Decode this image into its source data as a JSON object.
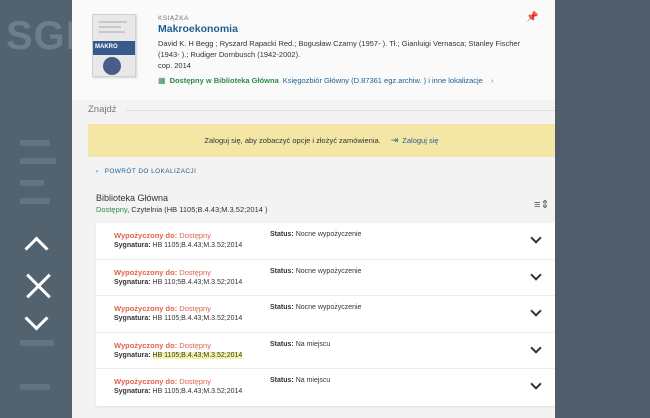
{
  "background": {
    "logo_text": "SGH"
  },
  "record": {
    "type": "KSIĄŻKA",
    "title": "Makroekonomia",
    "authors": "David K. H Begg ; Ryszard Rapacki Red.; Bogusław Czarny (1957- ). Tł.; Gianluigi Vernasca; Stanley Fischer (1943- ).; Rudiger Dornbusch (1942-2002).",
    "date": "cop. 2014",
    "availability_status": "Dostępny w Biblioteka Główna",
    "availability_location": "Księgozbiór Główny (D.87361 egz.archiw. ) i inne lokalizacje",
    "cover_band_text": "MAKRO"
  },
  "find": {
    "label": "Znajdź"
  },
  "login": {
    "message": "Zaloguj się, aby zobaczyć opcje i złożyć zamówienia.",
    "link_label": "Zaloguj się"
  },
  "back": {
    "label": "POWRÓT DO LOKALIZACJI"
  },
  "location": {
    "name": "Biblioteka Główna",
    "status": "Dostępny",
    "detail": ", Czytelnia (HB 1105;B.4.43;M.3.52;2014 )"
  },
  "items": [
    {
      "due_label": "Wypożyczony do:",
      "due_value": "Dostępny",
      "sig_label": "Sygnatura:",
      "sig_value": "HB 1105;B.4.43;M.3.52;2014",
      "status_label": "Status:",
      "status_value": "Nocne wypożyczenie"
    },
    {
      "due_label": "Wypożyczony do:",
      "due_value": "Dostępny",
      "sig_label": "Sygnatura:",
      "sig_value": "HB 110;5B.4.43;M.3.52;2014",
      "status_label": "Status:",
      "status_value": "Nocne wypożyczenie"
    },
    {
      "due_label": "Wypożyczony do:",
      "due_value": "Dostępny",
      "sig_label": "Sygnatura:",
      "sig_value": "HB 1105;B.4.43;M.3.52;2014",
      "status_label": "Status:",
      "status_value": "Nocne wypożyczenie"
    },
    {
      "due_label": "Wypożyczony do:",
      "due_value": "Dostępny",
      "sig_label": "Sygnatura:",
      "sig_value": "HB 1105;B.4.43;M.3.52;2014",
      "status_label": "Status:",
      "status_value": "Na miejscu"
    },
    {
      "due_label": "Wypożyczony do:",
      "due_value": "Dostępny",
      "sig_label": "Sygnatura:",
      "sig_value": "HB 1105;B.4.43;M.3.52;2014",
      "status_label": "Status:",
      "status_value": "Na miejscu"
    }
  ],
  "colors": {
    "link": "#1f5f8f",
    "available": "#2d8a4e",
    "due": "#e0634c",
    "banner": "#f4e7a5"
  }
}
